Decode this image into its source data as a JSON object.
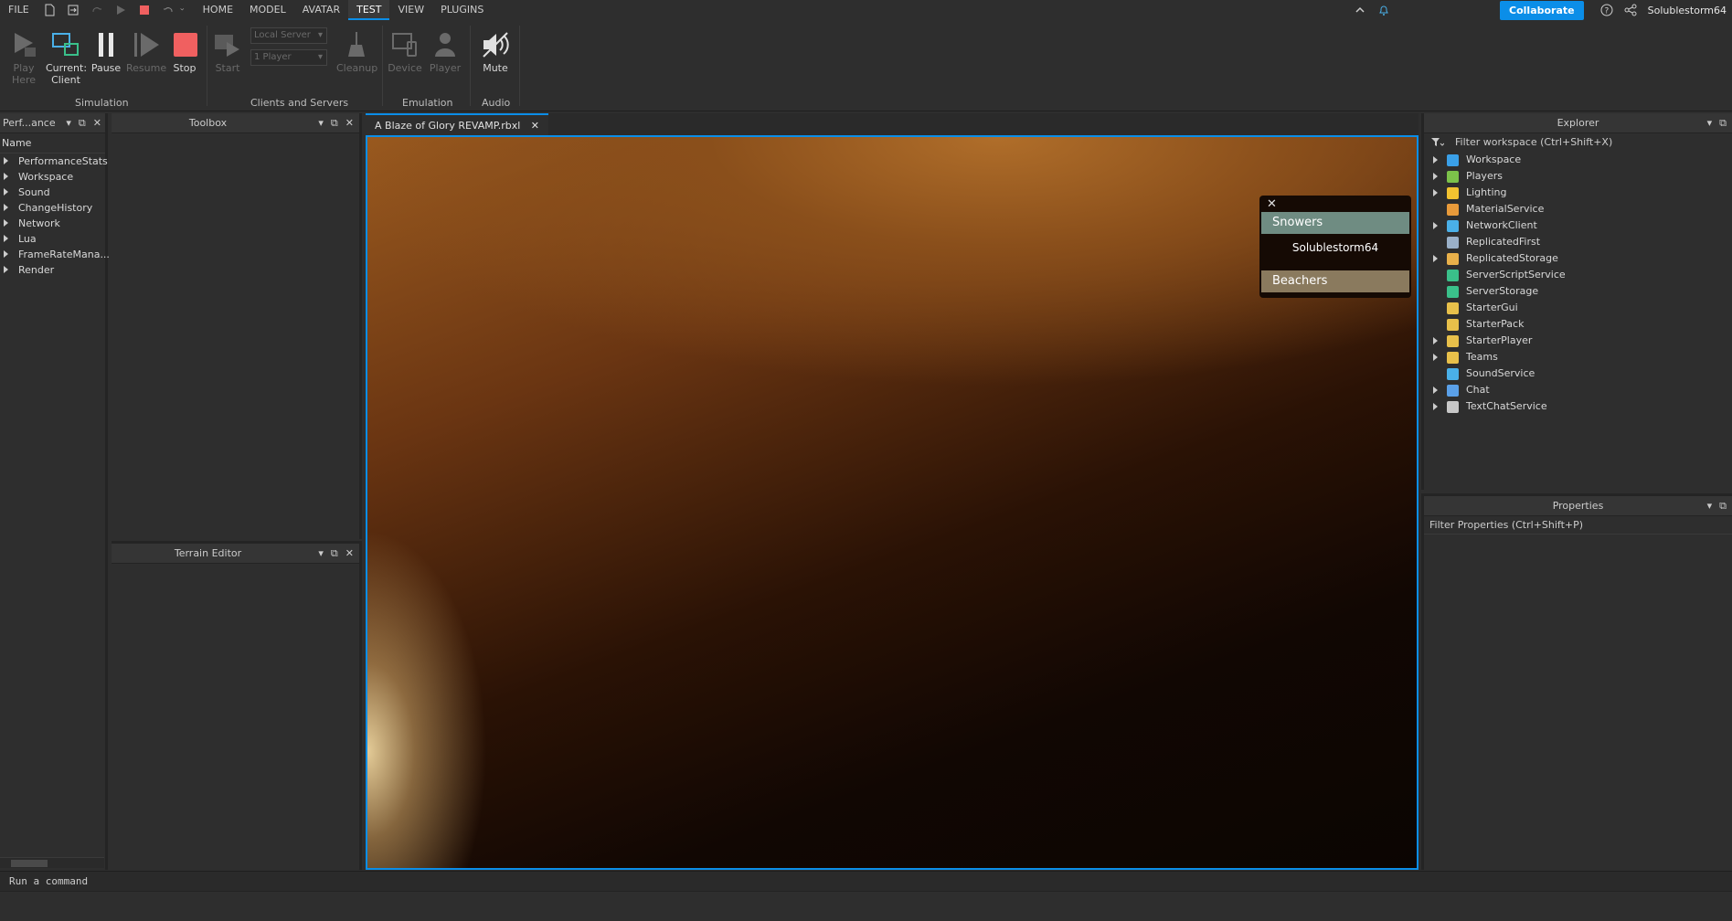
{
  "menu": {
    "file": "FILE",
    "tabs": [
      "HOME",
      "MODEL",
      "AVATAR",
      "TEST",
      "VIEW",
      "PLUGINS"
    ],
    "active_tab": "TEST",
    "collaborate": "Collaborate",
    "username": "Solublestorm64"
  },
  "ribbon": {
    "play_here": [
      "Play",
      "Here"
    ],
    "current_client": [
      "Current:",
      "Client"
    ],
    "pause": "Pause",
    "resume": "Resume",
    "stop": "Stop",
    "simulation": "Simulation",
    "start": "Start",
    "local_server": "Local Server",
    "players_count": "1 Player",
    "cleanup": "Cleanup",
    "clients_servers": "Clients and Servers",
    "device": "Device",
    "player": "Player",
    "emulation": "Emulation",
    "mute": "Mute",
    "audio": "Audio"
  },
  "perf": {
    "title": "Perf...ance",
    "column": "Name",
    "items": [
      "PerformanceStats",
      "Workspace",
      "Sound",
      "ChangeHistory",
      "Network",
      "Lua",
      "FrameRateMana...",
      "Render"
    ]
  },
  "toolbox": {
    "title": "Toolbox"
  },
  "terrain": {
    "title": "Terrain Editor"
  },
  "document": {
    "tab": "A Blaze of Glory REVAMP.rbxl"
  },
  "teams": {
    "team_a": "Snowers",
    "player": "Solublestorm64",
    "team_b": "Beachers"
  },
  "explorer": {
    "title": "Explorer",
    "filter": "Filter workspace (Ctrl+Shift+X)",
    "items": [
      {
        "name": "Workspace",
        "expandable": true,
        "color": "#3aa0e8"
      },
      {
        "name": "Players",
        "expandable": true,
        "color": "#7cc24a"
      },
      {
        "name": "Lighting",
        "expandable": true,
        "color": "#f2c230"
      },
      {
        "name": "MaterialService",
        "expandable": false,
        "color": "#e89a3a"
      },
      {
        "name": "NetworkClient",
        "expandable": true,
        "color": "#4ab0e8"
      },
      {
        "name": "ReplicatedFirst",
        "expandable": false,
        "color": "#9ab0c8"
      },
      {
        "name": "ReplicatedStorage",
        "expandable": true,
        "color": "#e8b04a"
      },
      {
        "name": "ServerScriptService",
        "expandable": false,
        "color": "#3ac08a"
      },
      {
        "name": "ServerStorage",
        "expandable": false,
        "color": "#3ac08a"
      },
      {
        "name": "StarterGui",
        "expandable": false,
        "color": "#e8c04a"
      },
      {
        "name": "StarterPack",
        "expandable": false,
        "color": "#e8c04a"
      },
      {
        "name": "StarterPlayer",
        "expandable": true,
        "color": "#e8c04a"
      },
      {
        "name": "Teams",
        "expandable": true,
        "color": "#e8c04a"
      },
      {
        "name": "SoundService",
        "expandable": false,
        "color": "#4ab0e8"
      },
      {
        "name": "Chat",
        "expandable": true,
        "color": "#5aa0e8"
      },
      {
        "name": "TextChatService",
        "expandable": true,
        "color": "#c8c8c8"
      }
    ]
  },
  "properties": {
    "title": "Properties",
    "filter": "Filter Properties (Ctrl+Shift+P)"
  },
  "command": {
    "placeholder": "Run a command"
  }
}
